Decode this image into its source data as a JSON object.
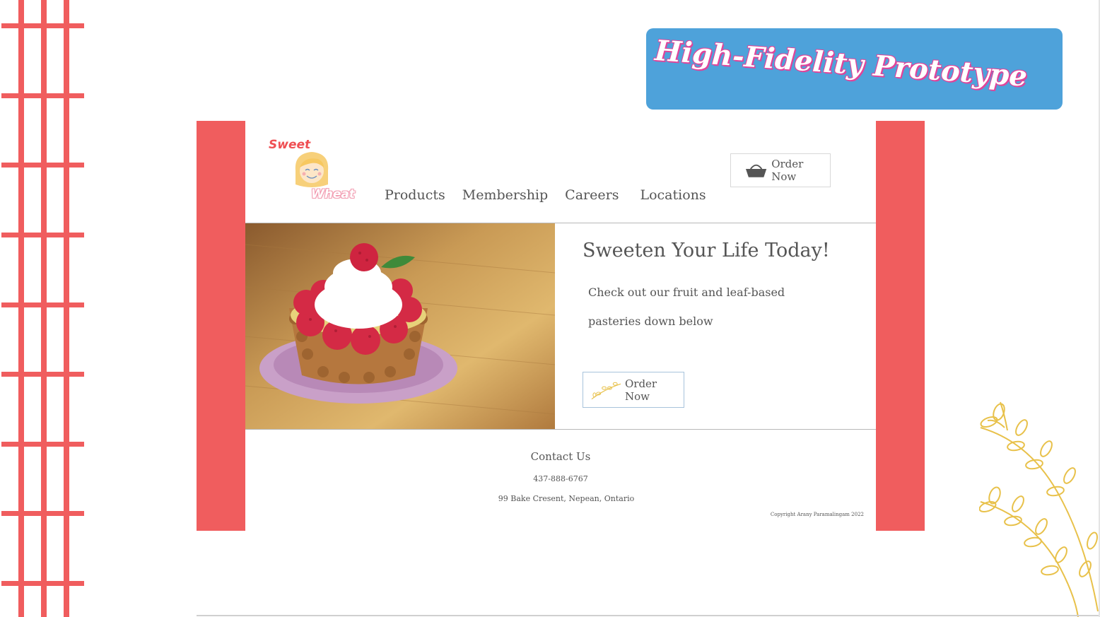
{
  "slide": {
    "title": "High-Fidelity Prototype",
    "colors": {
      "accent_red": "#f05d5e",
      "banner_blue": "#4ea2da",
      "branch_gold": "#e8c14a"
    }
  },
  "mockup": {
    "logo": {
      "top": "Sweet",
      "bottom": "Wheat",
      "icon": "girl-face-icon"
    },
    "nav": [
      {
        "label": "Products"
      },
      {
        "label": "Membership"
      },
      {
        "label": "Careers"
      },
      {
        "label": "Locations"
      }
    ],
    "header_order_button": {
      "label": "Order Now",
      "icon": "basket-icon"
    },
    "hero": {
      "image": "raspberry-tart-image",
      "title": "Sweeten Your Life Today!",
      "subtitle": "Check out our fruit and leaf-based pasteries down below",
      "order_button": {
        "label": "Order Now",
        "icon": "wheat-sprig-icon"
      }
    },
    "footer": {
      "title": "Contact Us",
      "phone": "437-888-6767",
      "address": "99 Bake Cresent, Nepean, Ontario",
      "copyright": "Copyright Arany Paramalingam 2022"
    }
  }
}
